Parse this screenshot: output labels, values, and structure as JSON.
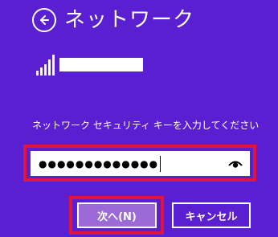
{
  "header": {
    "title": "ネットワーク",
    "back_icon": "back-arrow-circle-icon"
  },
  "network": {
    "signal_icon": "wifi-signal-icon",
    "signal_bars": 5
  },
  "prompt": {
    "text": "ネットワーク セキュリティ キーを入力してください"
  },
  "password": {
    "masked_value": "●●●●●●●●●●●●●",
    "reveal_icon": "eye-icon"
  },
  "buttons": {
    "next_label": "次へ(N)",
    "cancel_label": "キャンセル"
  },
  "colors": {
    "background": "#5a1fd1",
    "next_button": "#9b6ad6",
    "highlight": "#e0143c"
  }
}
